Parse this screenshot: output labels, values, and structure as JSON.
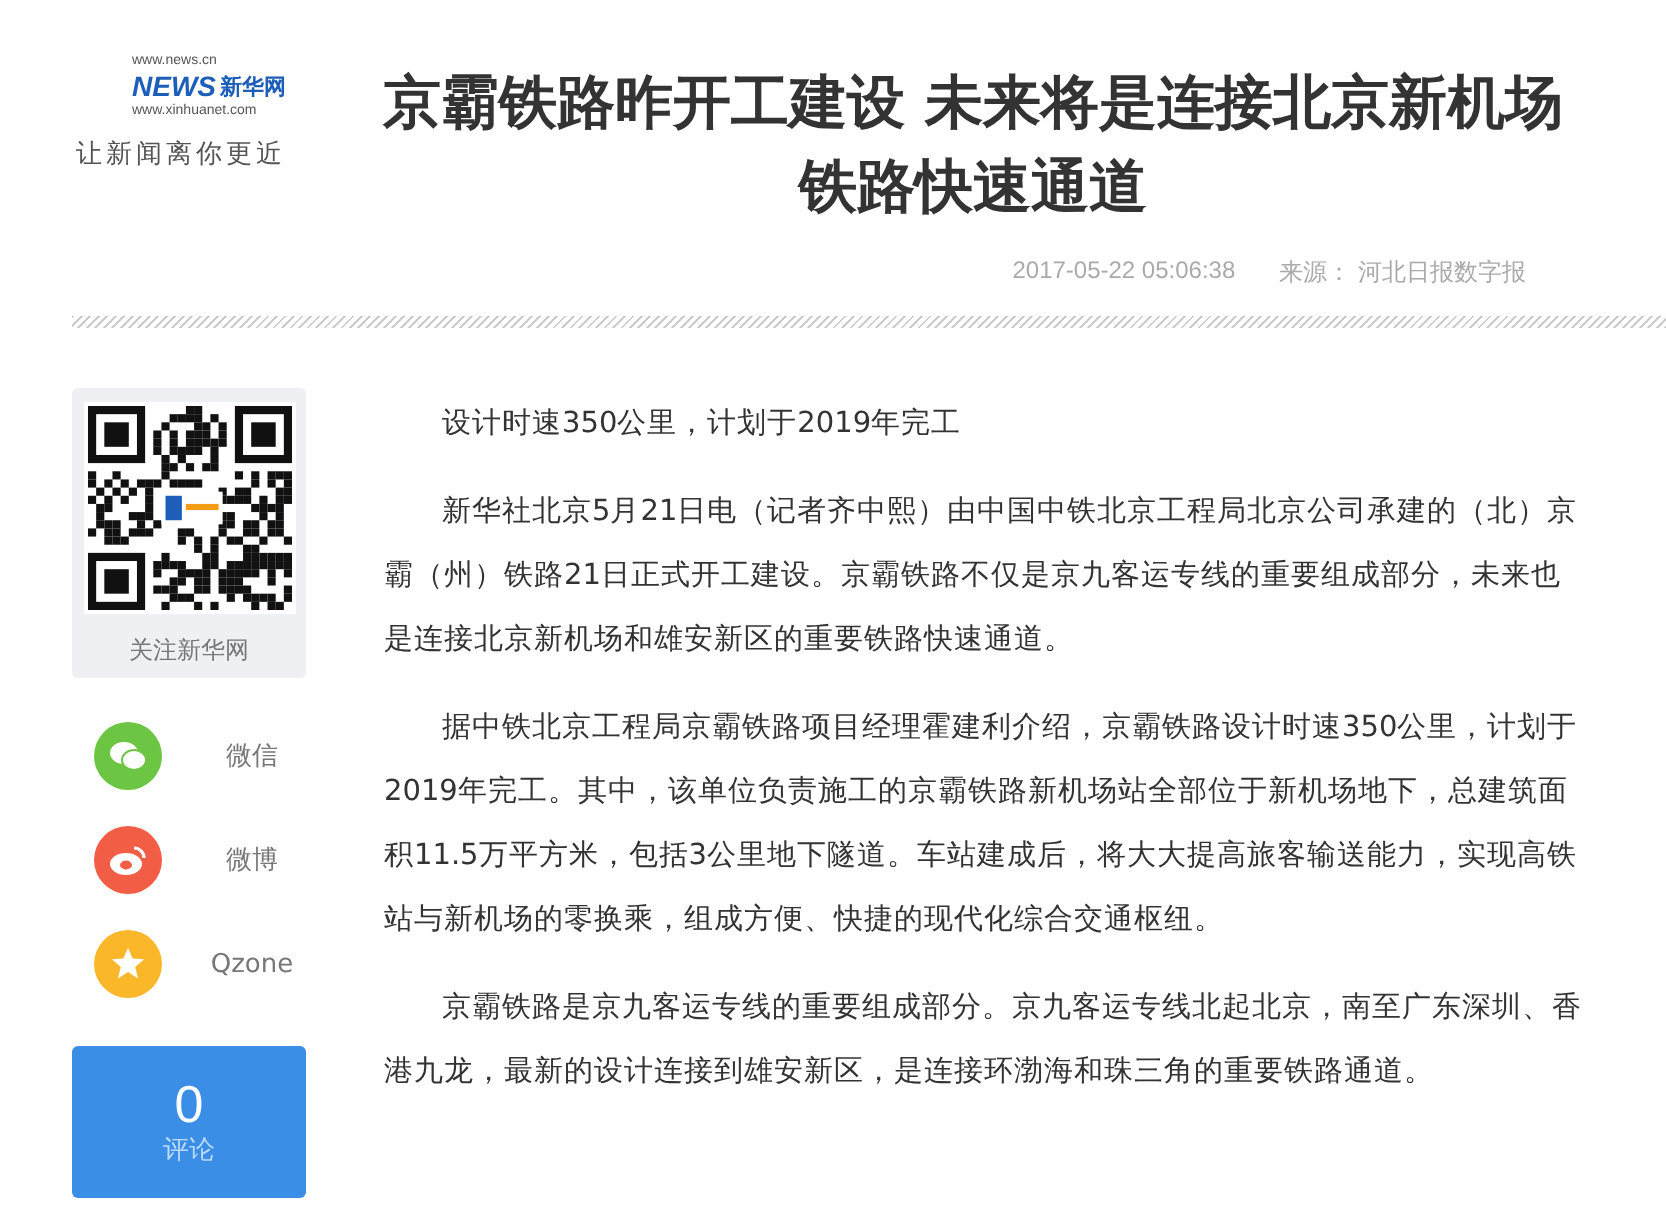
{
  "logo": {
    "url_top": "www.news.cn",
    "brand_cn": "新华网",
    "brand_en": "NEWS",
    "url_bottom": "www.xinhuanet.com",
    "slogan": "让新闻离你更近"
  },
  "article": {
    "title_lines": [
      "京霸铁路昨开工建设 未来将是连接北京新机场",
      "铁路快速通道"
    ],
    "date": "2017-05-22 05:06:38",
    "source": "来源： 河北日报数字报",
    "paragraphs": [
      "设计时速350公里，计划于2019年完工",
      "新华社北京5月21日电（记者齐中熙）由中国中铁北京工程局北京公司承建的（北）京霸（州）铁路21日正式开工建设。京霸铁路不仅是京九客运专线的重要组成部分，未来也是连接北京新机场和雄安新区的重要铁路快速通道。",
      "据中铁北京工程局京霸铁路项目经理霍建利介绍，京霸铁路设计时速350公里，计划于2019年完工。其中，该单位负责施工的京霸铁路新机场站全部位于新机场地下，总建筑面积11.5万平方米，包括3公里地下隧道。车站建成后，将大大提高旅客输送能力，实现高铁站与新机场的零换乘，组成方便、快捷的现代化综合交通枢纽。",
      "京霸铁路是京九客运专线的重要组成部分。京九客运专线北起北京，南至广东深圳、香港九龙，最新的设计连接到雄安新区，是连接环渤海和珠三角的重要铁路通道。"
    ]
  },
  "sidebar": {
    "qr_caption": "关注新华网",
    "share": [
      {
        "kind": "wechat",
        "label": "微信",
        "color": "#6cc644"
      },
      {
        "kind": "weibo",
        "label": "微博",
        "color": "#f25d45"
      },
      {
        "kind": "qzone",
        "label": "Qzone",
        "color": "#fbb72a"
      }
    ],
    "comments": {
      "count": "0",
      "label": "评论"
    }
  }
}
